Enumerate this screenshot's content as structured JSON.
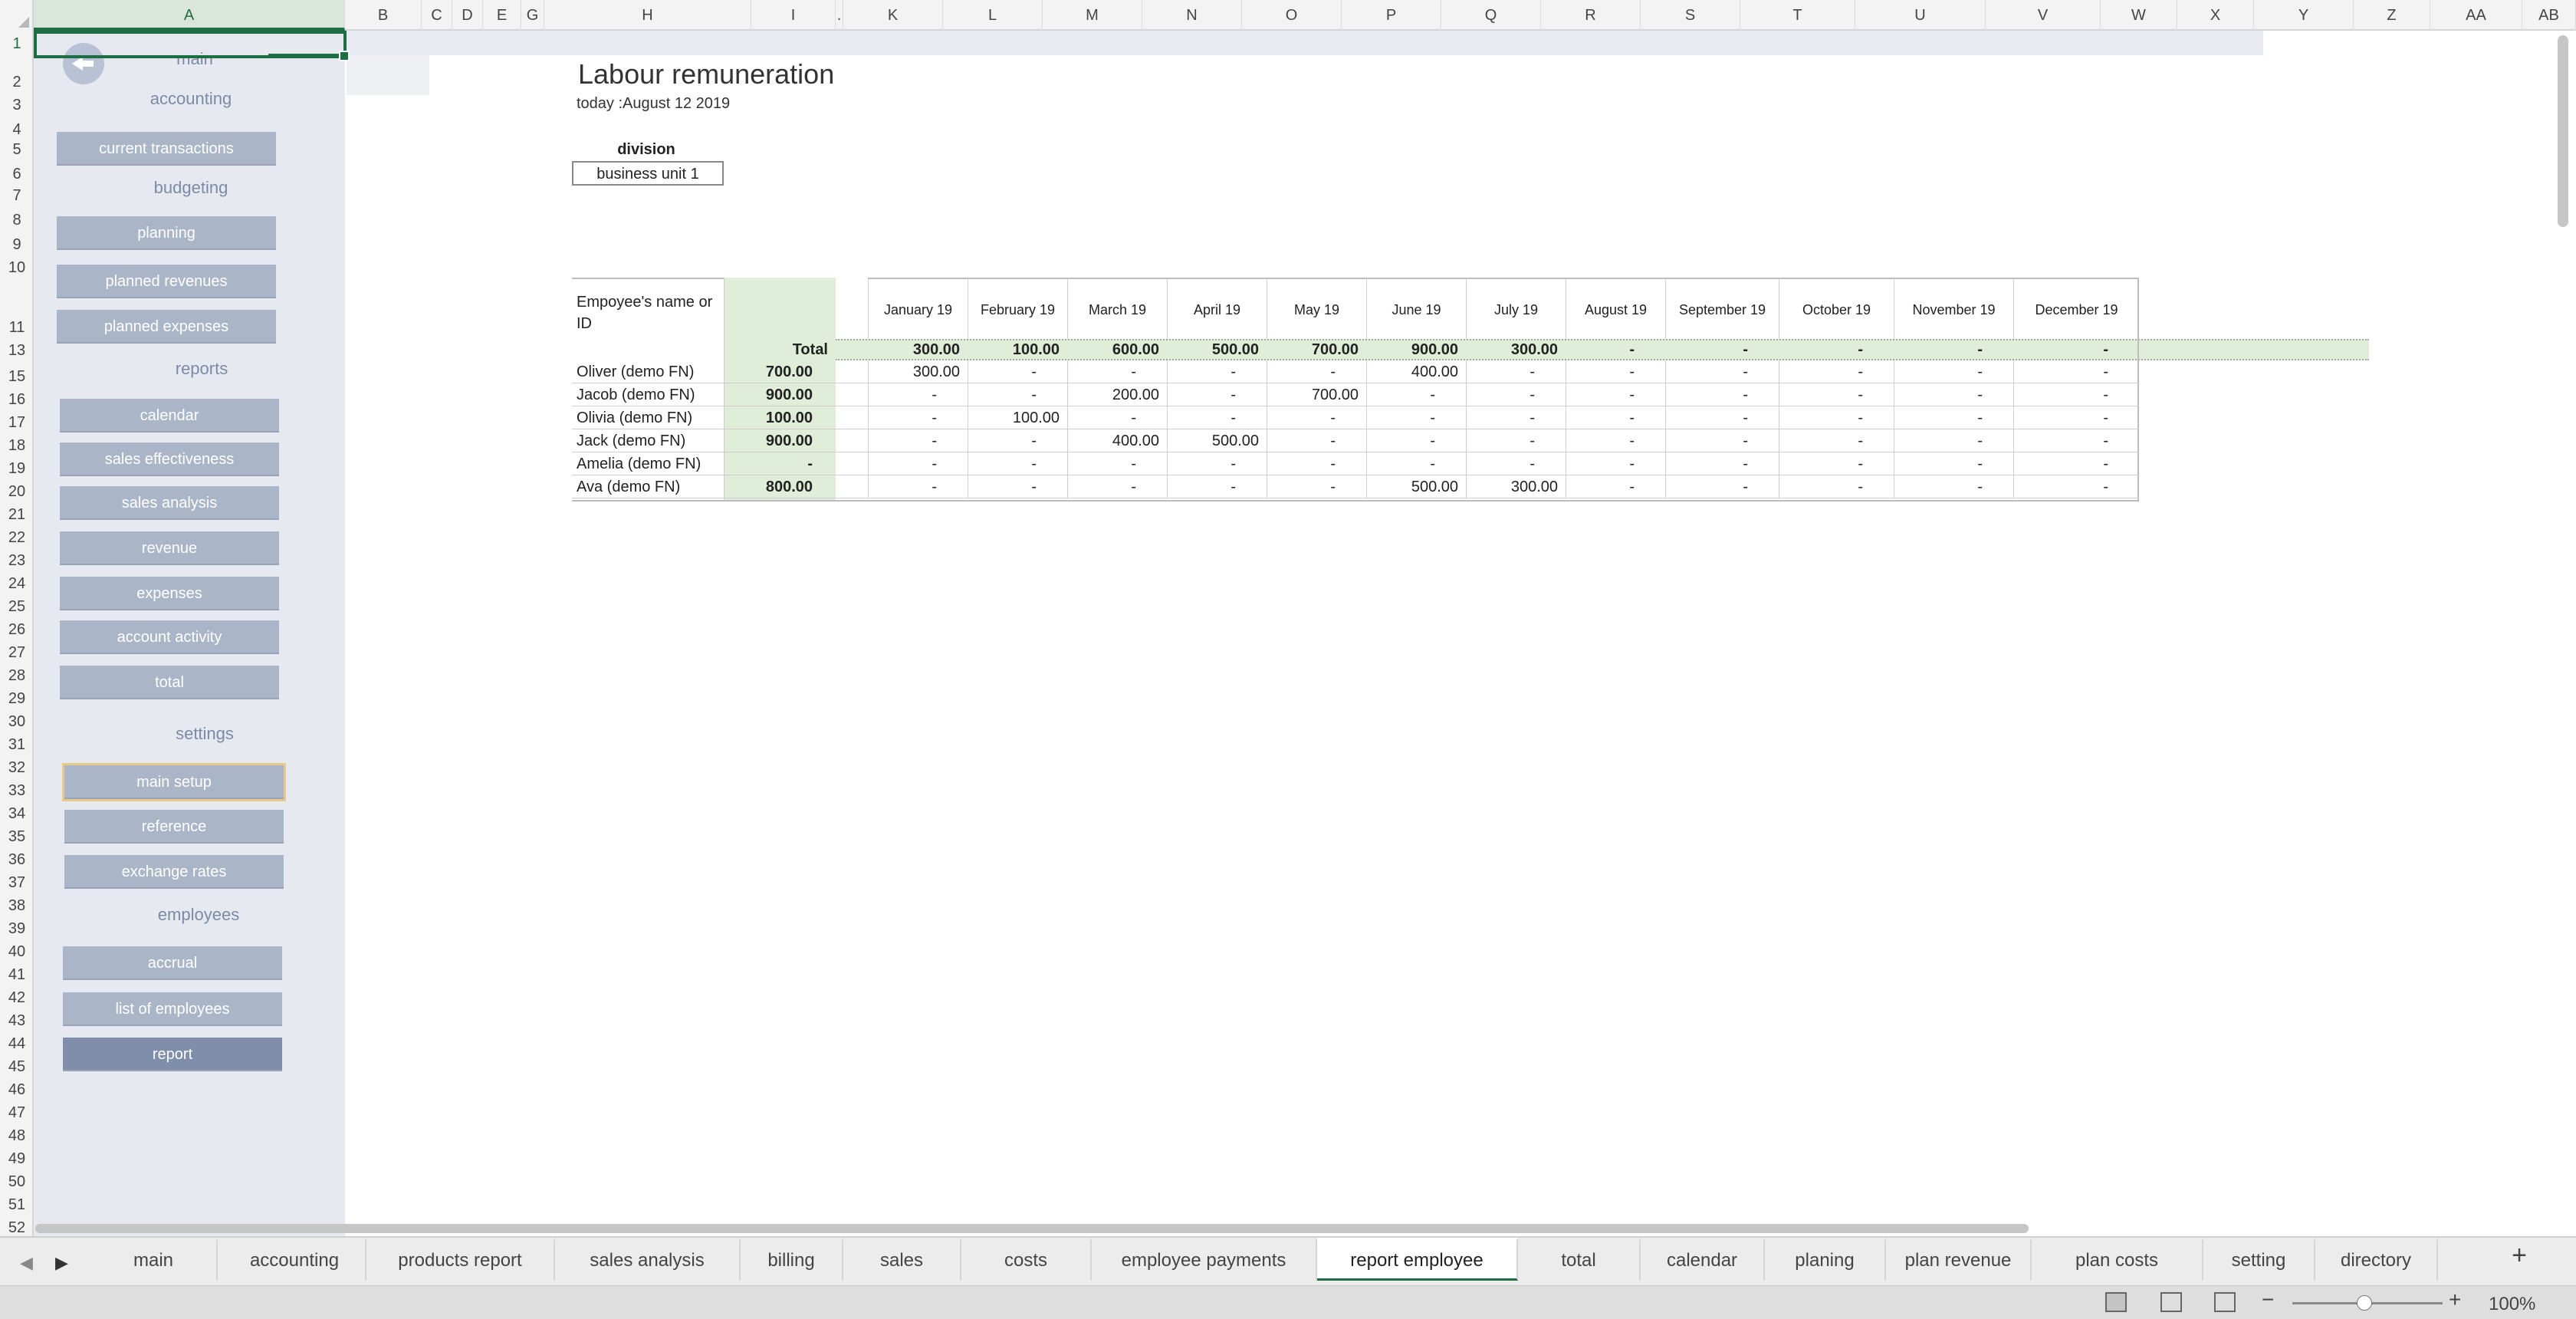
{
  "columns": [
    "A",
    "B",
    "C",
    "D",
    "E",
    "G",
    "H",
    "I",
    ".",
    "K",
    "L",
    "M",
    "N",
    "O",
    "P",
    "Q",
    "R",
    "S",
    "T",
    "U",
    "V",
    "W",
    "X",
    "Y",
    "Z",
    "AA",
    "AB"
  ],
  "rows": [
    "1",
    "2",
    "3",
    "4",
    "5",
    "6",
    "7",
    "8",
    "9",
    "10",
    "11",
    "13",
    "15",
    "16",
    "17",
    "18",
    "19",
    "20",
    "21",
    "22",
    "23",
    "24",
    "25",
    "26",
    "27",
    "28",
    "29",
    "30",
    "31",
    "32",
    "33",
    "34",
    "35",
    "36",
    "37",
    "38",
    "39",
    "40",
    "41",
    "42",
    "43",
    "44",
    "45",
    "46",
    "47",
    "48",
    "49",
    "50",
    "51",
    "52"
  ],
  "sidebar": {
    "main_label": "main",
    "sections": {
      "accounting": "accounting",
      "budgeting": "budgeting",
      "reports": "reports",
      "settings": "settings",
      "employees": "employees"
    },
    "buttons": {
      "current_transactions": "current transactions",
      "planning": "planning",
      "planned_revenues": "planned revenues",
      "planned_expenses": "planned expenses",
      "calendar": "calendar",
      "sales_effectiveness": "sales effectiveness",
      "sales_analysis": "sales analysis",
      "revenue": "revenue",
      "expenses": "expenses",
      "account_activity": "account activity",
      "total": "total",
      "main_setup": "main setup",
      "reference": "reference",
      "exchange_rates": "exchange rates",
      "accrual": "accrual",
      "list_of_employees": "list of employees",
      "report": "report"
    }
  },
  "report": {
    "title": "Labour remuneration",
    "today": "today :August 12 2019",
    "division_label": "division",
    "division_value": "business unit 1",
    "name_header": "Empoyee's name or ID",
    "total_label": "Total",
    "months": [
      "January 19",
      "February 19",
      "March 19",
      "April 19",
      "May 19",
      "June 19",
      "July 19",
      "August 19",
      "September 19",
      "October 19",
      "November 19",
      "December 19"
    ],
    "totals": [
      "300.00",
      "100.00",
      "600.00",
      "500.00",
      "700.00",
      "900.00",
      "300.00",
      "-",
      "-",
      "-",
      "-",
      "-"
    ],
    "employees": [
      {
        "name": "Oliver (demo FN)",
        "total": "700.00",
        "values": [
          "300.00",
          "-",
          "-",
          "-",
          "-",
          "400.00",
          "-",
          "-",
          "-",
          "-",
          "-",
          "-"
        ]
      },
      {
        "name": "Jacob  (demo FN)",
        "total": "900.00",
        "values": [
          "-",
          "-",
          "200.00",
          "-",
          "700.00",
          "-",
          "-",
          "-",
          "-",
          "-",
          "-",
          "-"
        ]
      },
      {
        "name": "Olivia (demo FN)",
        "total": "100.00",
        "values": [
          "-",
          "100.00",
          "-",
          "-",
          "-",
          "-",
          "-",
          "-",
          "-",
          "-",
          "-",
          "-"
        ]
      },
      {
        "name": "Jack (demo FN)",
        "total": "900.00",
        "values": [
          "-",
          "-",
          "400.00",
          "500.00",
          "-",
          "-",
          "-",
          "-",
          "-",
          "-",
          "-",
          "-"
        ]
      },
      {
        "name": "Amelia (demo FN)",
        "total": "-",
        "values": [
          "-",
          "-",
          "-",
          "-",
          "-",
          "-",
          "-",
          "-",
          "-",
          "-",
          "-",
          "-"
        ]
      },
      {
        "name": "Ava (demo FN)",
        "total": "800.00",
        "values": [
          "-",
          "-",
          "-",
          "-",
          "-",
          "500.00",
          "300.00",
          "-",
          "-",
          "-",
          "-",
          "-"
        ]
      }
    ]
  },
  "sheet_tabs": [
    "main",
    "accounting",
    "products report",
    "sales analysis",
    "billing",
    "sales",
    "costs",
    "employee payments",
    "report employee",
    "total",
    "calendar",
    "planing",
    "plan revenue",
    "plan costs",
    "setting",
    "directory"
  ],
  "active_tab": "report employee",
  "status": {
    "zoom": "100%"
  },
  "colors": {
    "accent": "#1f6e43",
    "sidebar_bg": "#e6e9ef",
    "nav_button": "#aab5c7",
    "section_text": "#7d8aa6",
    "total_fill": "#e0edd8"
  }
}
